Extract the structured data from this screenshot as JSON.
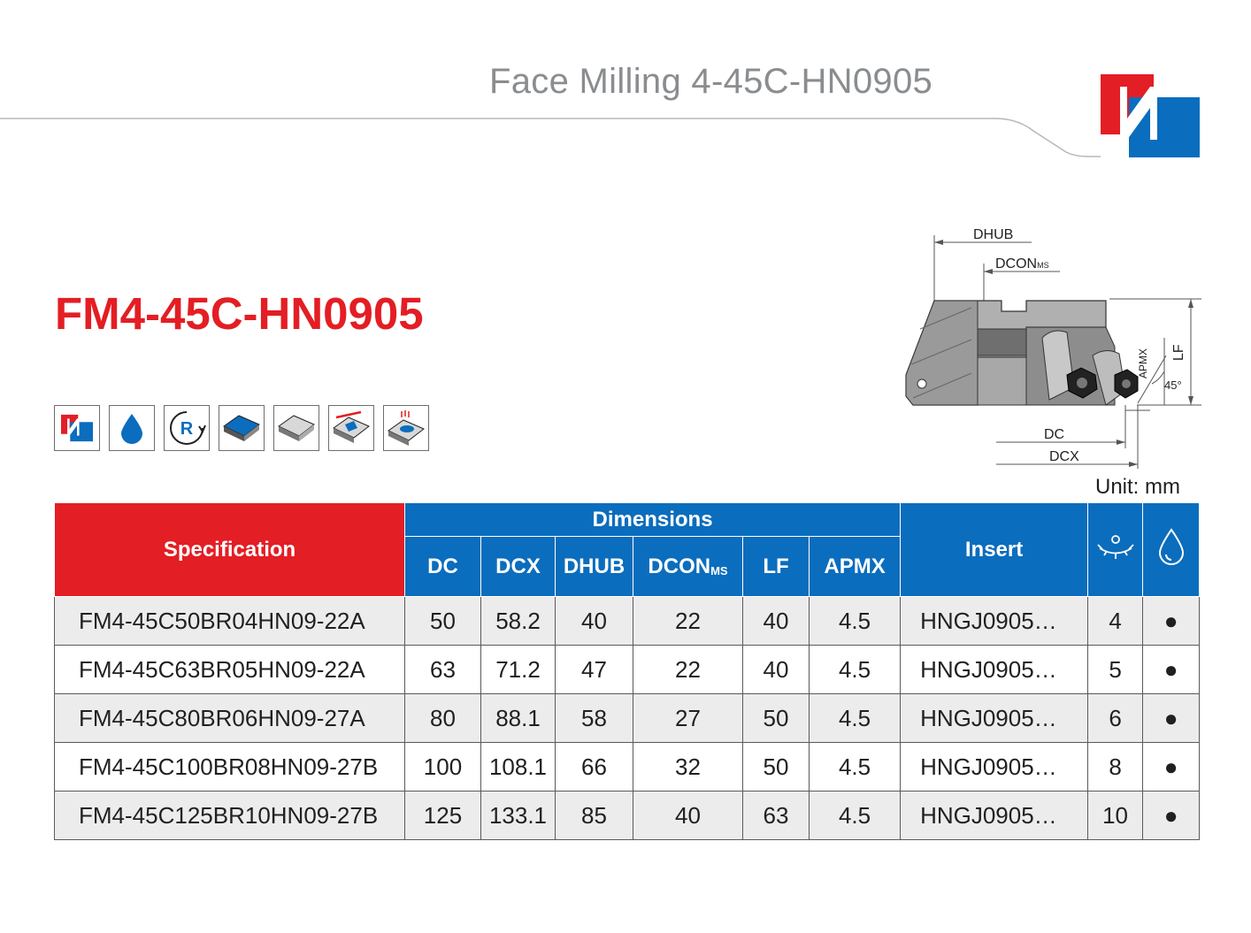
{
  "header": {
    "title": "Face Milling 4-45C-HN0905"
  },
  "product": {
    "title": "FM4-45C-HN0905"
  },
  "feature_icons": [
    "brand-logo-icon",
    "coolant-drop-icon",
    "rotation-r-icon",
    "insert-blue-icon",
    "insert-gray-icon",
    "insert-angle-icon",
    "insert-coolant-icon"
  ],
  "drawing": {
    "labels": {
      "dhub": "DHUB",
      "dcon": "DCON",
      "dcon_sub": "MS",
      "apmx": "APMX",
      "lf": "LF",
      "angle": "45°",
      "dc": "DC",
      "dcx": "DCX"
    }
  },
  "unit": "Unit: mm",
  "table": {
    "header": {
      "spec": "Specification",
      "dimensions": "Dimensions",
      "insert": "Insert",
      "cols": {
        "dc": "DC",
        "dcx": "DCX",
        "dhub": "DHUB",
        "dcon": "DCON",
        "dcon_sub": "MS",
        "lf": "LF",
        "apmx": "APMX"
      }
    },
    "rows": [
      {
        "spec": "FM4-45C50BR04HN09-22A",
        "dc": "50",
        "dcx": "58.2",
        "dhub": "40",
        "dcon": "22",
        "lf": "40",
        "apmx": "4.5",
        "insert": "HNGJ0905…",
        "teeth": "4",
        "coolant": "●"
      },
      {
        "spec": "FM4-45C63BR05HN09-22A",
        "dc": "63",
        "dcx": "71.2",
        "dhub": "47",
        "dcon": "22",
        "lf": "40",
        "apmx": "4.5",
        "insert": "HNGJ0905…",
        "teeth": "5",
        "coolant": "●"
      },
      {
        "spec": "FM4-45C80BR06HN09-27A",
        "dc": "80",
        "dcx": "88.1",
        "dhub": "58",
        "dcon": "27",
        "lf": "50",
        "apmx": "4.5",
        "insert": "HNGJ0905…",
        "teeth": "6",
        "coolant": "●"
      },
      {
        "spec": "FM4-45C100BR08HN09-27B",
        "dc": "100",
        "dcx": "108.1",
        "dhub": "66",
        "dcon": "32",
        "lf": "50",
        "apmx": "4.5",
        "insert": "HNGJ0905…",
        "teeth": "8",
        "coolant": "●"
      },
      {
        "spec": "FM4-45C125BR10HN09-27B",
        "dc": "125",
        "dcx": "133.1",
        "dhub": "85",
        "dcon": "40",
        "lf": "63",
        "apmx": "4.5",
        "insert": "HNGJ0905…",
        "teeth": "10",
        "coolant": "●"
      }
    ]
  },
  "colors": {
    "brand_red": "#e31e24",
    "brand_blue": "#0b6dbd",
    "header_gray": "#8a8d90"
  }
}
